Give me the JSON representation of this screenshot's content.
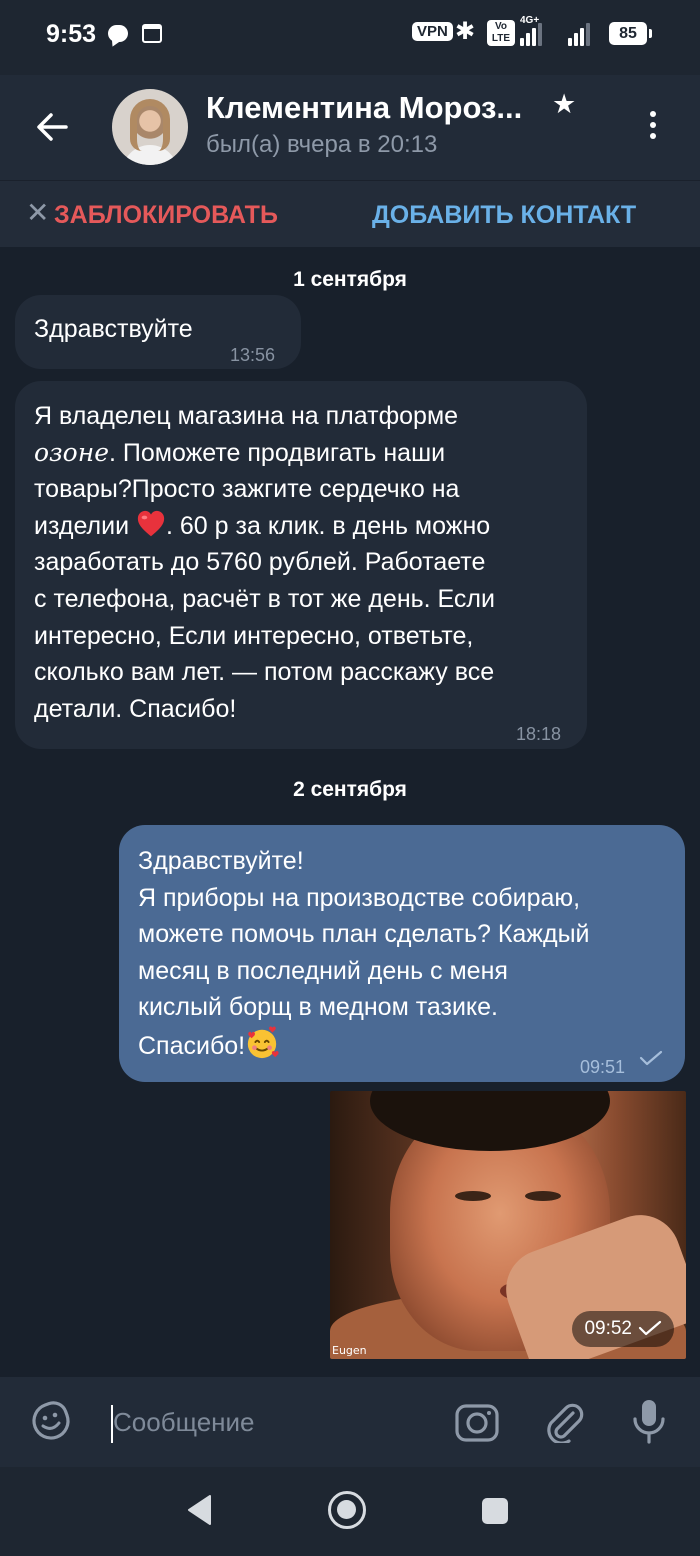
{
  "status_bar": {
    "time": "9:53",
    "vpn": "VPN",
    "volte": "Vo LTE",
    "network": "4G+",
    "battery": "85"
  },
  "header": {
    "contact_name": "Клементина Мороз...",
    "last_seen": "был(а) вчера в 20:13",
    "favorite_icon": "star-icon",
    "avatar_icon": "contact-avatar"
  },
  "action_bar": {
    "block_label": "ЗАБЛОКИРОВАТЬ",
    "add_contact_label": "ДОБАВИТЬ КОНТАКТ",
    "block_color": "#e5595a",
    "add_color": "#6ab1e8"
  },
  "dates": [
    "1 сентября",
    "2 сентября"
  ],
  "messages": [
    {
      "direction": "incoming",
      "text": "Здравствуйте",
      "time": "13:56"
    },
    {
      "direction": "incoming",
      "lines": [
        "Я владелец магазина на платформе",
        "озонe. Поможете продвигать наши",
        "товары?Просто зажгите сердечко на",
        "изделии",
        ". 60 р за клик. в день можно",
        "заработать до 5760 рублей. Работаете",
        "с телефона, расчёт в тот же день. Если",
        "интересно, Если интересно, ответьте,",
        "сколько вам лет. — потом расскажу все",
        "детали. Спасибо!"
      ],
      "emoji": "red-heart",
      "time": "18:18"
    },
    {
      "direction": "outgoing",
      "lines": [
        "Здравствуйте!",
        "Я приборы на производстве собираю,",
        "можете помочь план сделать? Каждый",
        "месяц в последний день с меня",
        "кислый борщ в медном тазике.",
        "Спасибо!"
      ],
      "emoji": "smiling-face-with-hearts",
      "time": "09:51",
      "status": "sent"
    },
    {
      "direction": "outgoing",
      "type": "photo",
      "watermark": "Eugen",
      "time": "09:52",
      "status": "sent"
    }
  ],
  "input_bar": {
    "placeholder": "Сообщение"
  },
  "colors": {
    "background": "#18202b",
    "header": "#222b38",
    "incoming_bubble": "#222b38",
    "outgoing_bubble": "#4b6a94",
    "muted_text": "#8e99a8"
  }
}
